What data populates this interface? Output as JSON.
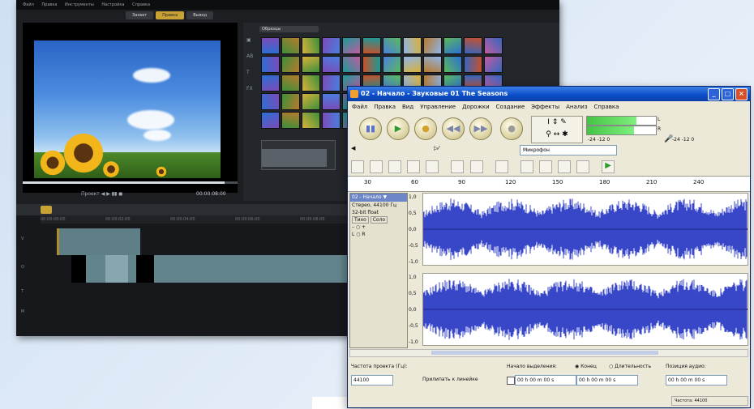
{
  "video_editor": {
    "menu": [
      "Файл",
      "Правка",
      "Инструменты",
      "Настройка",
      "Справка"
    ],
    "tabs": [
      "Захват",
      "Правка",
      "Вывод"
    ],
    "active_tab_index": 1,
    "library_folder": "Образцы",
    "preview_controls": "Проект  ◀  ▶  ▮▮  ◼",
    "timecode": "00:00:08:00",
    "ruler": [
      "00:00:00:00",
      "00:00:02:00",
      "00:00:04:00",
      "00:00:06:00",
      "00:00:08:00",
      "00:00:10:00",
      "00:00:12:00",
      "00:00:14:00"
    ],
    "track_labels": [
      "V",
      "O",
      "T",
      "M"
    ]
  },
  "audacity": {
    "title": "02 - Начало - Звуковые 01 The Seasons",
    "menu": [
      "Файл",
      "Правка",
      "Вид",
      "Управление",
      "Дорожки",
      "Создание",
      "Эффекты",
      "Анализ",
      "Справка"
    ],
    "transport": [
      "▮▮",
      "▶",
      "●",
      "◀◀",
      "▶▶",
      "●"
    ],
    "meter_labels": [
      "L",
      "R"
    ],
    "meter_values": [
      "-24  -12  0",
      "-24  -12  0"
    ],
    "input_device": "Микрофон",
    "ruler": [
      "30",
      "60",
      "90",
      "120",
      "150",
      "180",
      "210",
      "240"
    ],
    "track": {
      "name": "02 - Начало ▼",
      "format": "Стерео, 44100 Гц",
      "bits": "32-bit float",
      "mute": "Тихо",
      "solo": "Соло",
      "amp_top": [
        "1,0",
        "0,5",
        "0,0",
        "-0,5",
        "-1,0"
      ],
      "amp_bottom": [
        "1,0",
        "0,5",
        "0,0",
        "-0,5",
        "-1,0"
      ]
    },
    "bottom": {
      "rate_label": "Частота проекта (Гц):",
      "rate_value": "44100",
      "snap_label": "Прилипать к линейке",
      "sel_start_label": "Начало выделения:",
      "end_label": "Конец",
      "length_label": "Длительность",
      "position_label": "Позиция аудио:",
      "sel_start": "00 h 00 m 00 s",
      "sel_end": "00 h 00 m 00 s",
      "audio_pos": "00 h 00 m 00 s",
      "status": "Частота: 44100"
    }
  },
  "colors": {
    "wave": "#3747c8",
    "wave_center": "#2a36a8",
    "accent_gold": "#c9a236"
  }
}
